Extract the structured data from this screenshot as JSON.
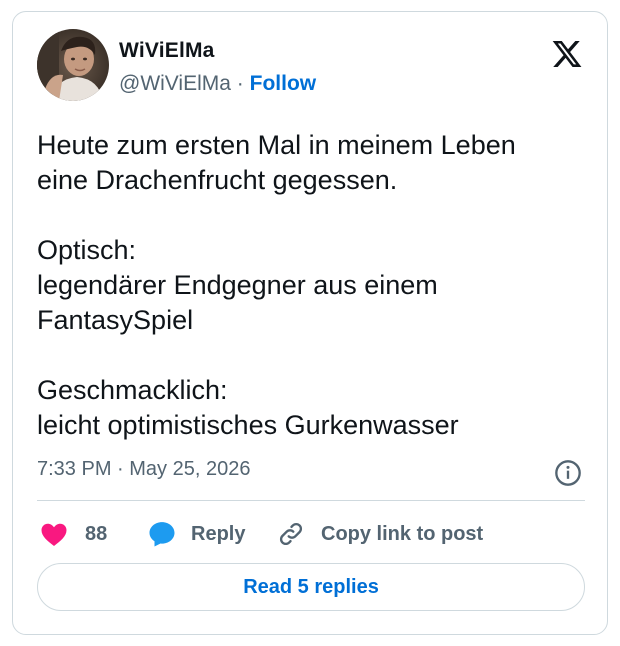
{
  "author": {
    "display_name": "WiViElMa",
    "handle": "@WiViElMa",
    "separator": "·",
    "follow_label": "Follow"
  },
  "icons": {
    "brand": "x-logo-icon",
    "info": "info-icon",
    "like": "heart-icon",
    "reply": "speech-bubble-icon",
    "copy": "link-icon"
  },
  "tweet": {
    "text": "Heute zum ersten Mal in meinem Leben\neine Drachenfrucht gegessen.\n\nOptisch:\nlegendärer Endgegner aus einem\nFantasySpiel\n\nGeschmacklich:\nleicht optimistisches Gurkenwasser",
    "timestamp": "7:33 PM · May 25, 2026"
  },
  "actions": {
    "like_count": "88",
    "reply_label": "Reply",
    "copy_label": "Copy link to post"
  },
  "footer": {
    "read_replies_label": "Read 5 replies"
  },
  "colors": {
    "link_blue": "#006fd6",
    "heart_pink": "#f91880",
    "reply_blue": "#1d9bf0",
    "muted_text": "#536471",
    "border": "#cfd9de"
  }
}
